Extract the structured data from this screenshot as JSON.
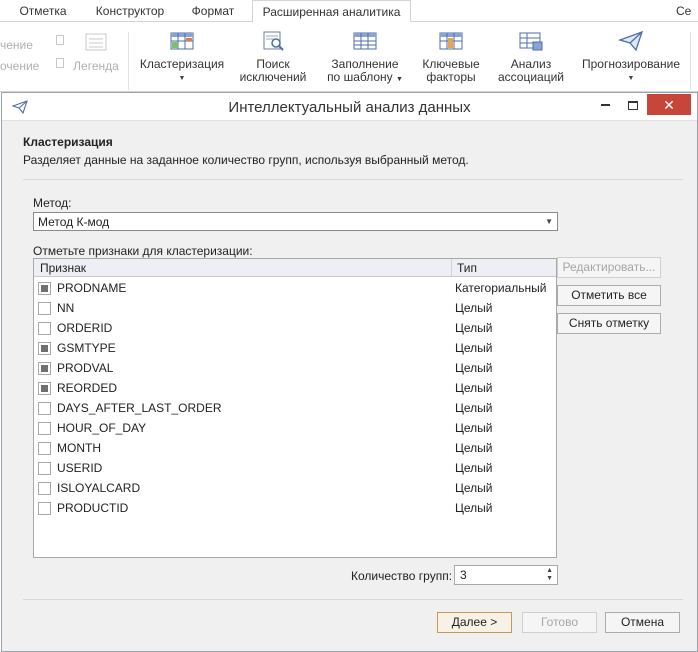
{
  "ribbon": {
    "tabs": [
      "Отметка",
      "Конструктор",
      "Формат",
      "Расширенная аналитика",
      "Се"
    ],
    "faded": [
      "чение",
      "очение",
      "Легенда"
    ],
    "buttons": [
      {
        "label1": "Кластеризация",
        "label2": "",
        "icon": "table-cluster-icon"
      },
      {
        "label1": "Поиск",
        "label2": "исключений",
        "icon": "table-search-icon"
      },
      {
        "label1": "Заполнение",
        "label2": "по шаблону",
        "icon": "table-fill-icon"
      },
      {
        "label1": "Ключевые",
        "label2": "факторы",
        "icon": "table-factors-icon"
      },
      {
        "label1": "Анализ",
        "label2": "ассоциаций",
        "icon": "table-association-icon"
      },
      {
        "label1": "Прогнозирование",
        "label2": "",
        "icon": "paper-plane-icon"
      }
    ]
  },
  "dialog": {
    "title": "Интеллектуальный анализ данных",
    "heading": "Кластеризация",
    "description": "Разделяет данные на заданное количество групп, используя выбранный метод.",
    "method_label": "Метод:",
    "method_value": "Метод К-мод",
    "features_label": "Отметьте признаки для кластеризации:",
    "col_feature": "Признак",
    "col_type": "Тип",
    "features": [
      {
        "name": "PRODNAME",
        "type": "Категориальный",
        "checked": true
      },
      {
        "name": "NN",
        "type": "Целый",
        "checked": false
      },
      {
        "name": "ORDERID",
        "type": "Целый",
        "checked": false
      },
      {
        "name": "GSMTYPE",
        "type": "Целый",
        "checked": true
      },
      {
        "name": "PRODVAL",
        "type": "Целый",
        "checked": true
      },
      {
        "name": "REORDED",
        "type": "Целый",
        "checked": true
      },
      {
        "name": "DAYS_AFTER_LAST_ORDER",
        "type": "Целый",
        "checked": false
      },
      {
        "name": "HOUR_OF_DAY",
        "type": "Целый",
        "checked": false
      },
      {
        "name": "MONTH",
        "type": "Целый",
        "checked": false
      },
      {
        "name": "USERID",
        "type": "Целый",
        "checked": false
      },
      {
        "name": "ISLOYALCARD",
        "type": "Целый",
        "checked": false
      },
      {
        "name": "PRODUCTID",
        "type": "Целый",
        "checked": false
      }
    ],
    "btn_edit": "Редактировать...",
    "btn_check_all": "Отметить все",
    "btn_uncheck": "Снять отметку",
    "groups_label": "Количество групп:",
    "groups_value": "3",
    "btn_next": "Далее >",
    "btn_done": "Готово",
    "btn_cancel": "Отмена"
  }
}
